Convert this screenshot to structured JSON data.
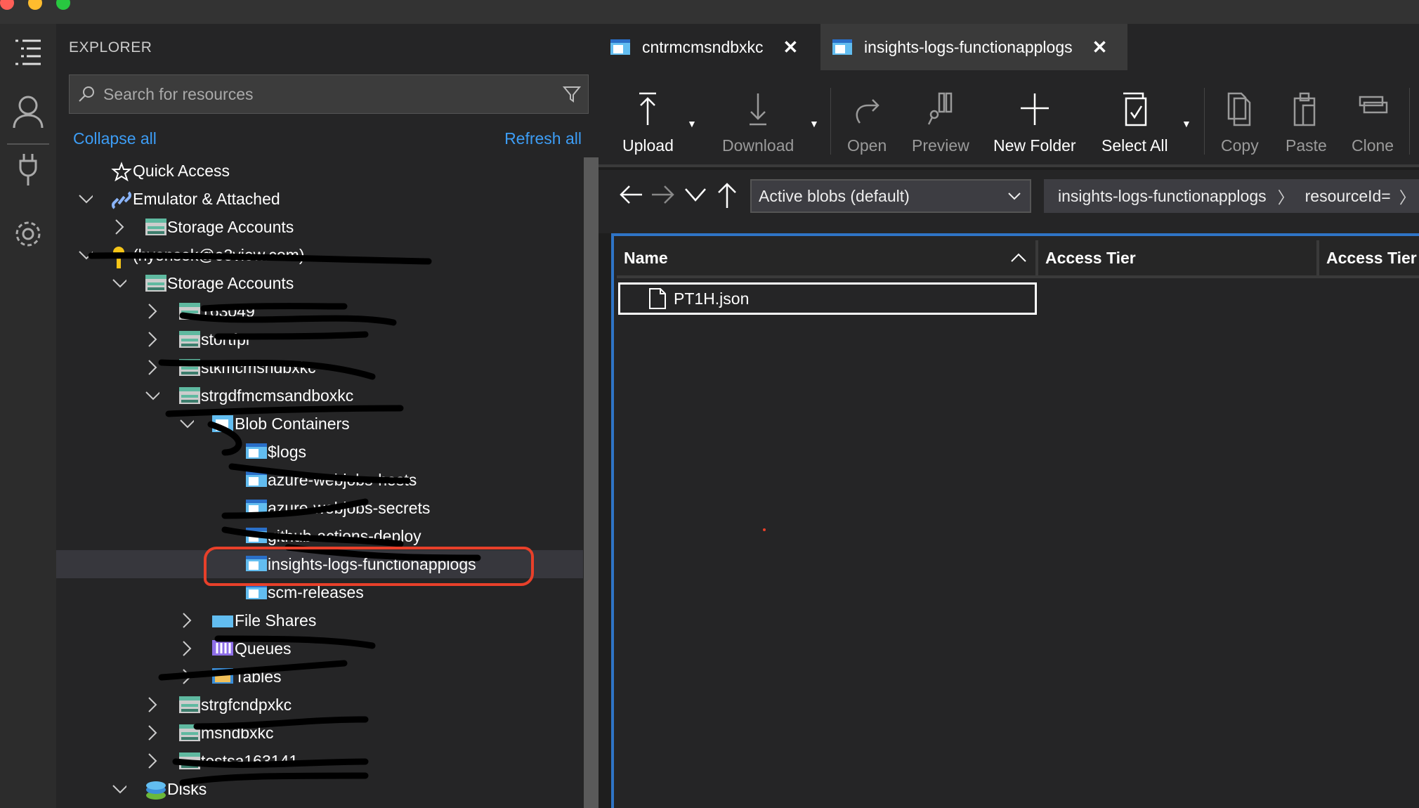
{
  "window": {
    "traffic_lights": [
      "#ff5f57",
      "#febc2e",
      "#28c840"
    ]
  },
  "activity_bar": [
    {
      "icon": "explorer-icon"
    },
    {
      "icon": "account-icon"
    },
    {
      "icon": "plug-icon"
    },
    {
      "icon": "gear-icon"
    }
  ],
  "sidebar": {
    "title": "EXPLORER",
    "search_placeholder": "Search for resources",
    "collapse_all": "Collapse all",
    "refresh_all": "Refresh all",
    "tree": [
      {
        "label": "Quick Access",
        "depth": 0,
        "state": "none",
        "icon": "quick-access"
      },
      {
        "label": "Emulator & Attached",
        "depth": 0,
        "state": "expanded",
        "icon": "link"
      },
      {
        "label": "Storage Accounts",
        "depth": 1,
        "state": "collapsed",
        "icon": "storage"
      },
      {
        "label": "(hyonsek@e3view.com)",
        "depth": 0,
        "state": "expanded",
        "icon": "key"
      },
      {
        "label": "Storage Accounts",
        "depth": 1,
        "state": "expanded",
        "icon": "storage"
      },
      {
        "label": "163049",
        "depth": 2,
        "state": "collapsed",
        "icon": "storage"
      },
      {
        "label": "stortfpr",
        "depth": 2,
        "state": "collapsed",
        "icon": "storage"
      },
      {
        "label": "stkmcmsndbxkc",
        "depth": 2,
        "state": "collapsed",
        "icon": "storage"
      },
      {
        "label": "strgdfmcmsandboxkc",
        "depth": 2,
        "state": "expanded",
        "icon": "storage"
      },
      {
        "label": "Blob Containers",
        "depth": 3,
        "state": "expanded",
        "icon": "blob"
      },
      {
        "label": "$logs",
        "depth": 4,
        "state": "none",
        "icon": "container"
      },
      {
        "label": "azure-webjobs-hosts",
        "depth": 4,
        "state": "none",
        "icon": "container"
      },
      {
        "label": "azure-webjobs-secrets",
        "depth": 4,
        "state": "none",
        "icon": "container"
      },
      {
        "label": "github-actions-deploy",
        "depth": 4,
        "state": "none",
        "icon": "container"
      },
      {
        "label": "insights-logs-functionapplogs",
        "depth": 4,
        "state": "none",
        "icon": "container",
        "selected": true
      },
      {
        "label": "scm-releases",
        "depth": 4,
        "state": "none",
        "icon": "container"
      },
      {
        "label": "File Shares",
        "depth": 3,
        "state": "collapsed",
        "icon": "fileshare"
      },
      {
        "label": "Queues",
        "depth": 3,
        "state": "collapsed",
        "icon": "queue"
      },
      {
        "label": "Tables",
        "depth": 3,
        "state": "collapsed",
        "icon": "table"
      },
      {
        "label": "strgfcndpxkc",
        "depth": 2,
        "state": "collapsed",
        "icon": "storage"
      },
      {
        "label": "msndbxkc",
        "depth": 2,
        "state": "collapsed",
        "icon": "storage"
      },
      {
        "label": "testsa163141",
        "depth": 2,
        "state": "collapsed",
        "icon": "storage"
      },
      {
        "label": "Disks",
        "depth": 1,
        "state": "expanded",
        "icon": "disk"
      }
    ]
  },
  "tabs": [
    {
      "label": "cntrmcmsndbxkc",
      "active": false
    },
    {
      "label": "insights-logs-functionapplogs",
      "active": true
    }
  ],
  "toolbar": {
    "upload": "Upload",
    "download": "Download",
    "open": "Open",
    "preview": "Preview",
    "new_folder": "New Folder",
    "select_all": "Select All",
    "copy": "Copy",
    "paste": "Paste",
    "clone": "Clone"
  },
  "nav": {
    "filter": "Active blobs (default)",
    "breadcrumb": [
      "insights-logs-functionapplogs",
      "resourceId="
    ]
  },
  "grid": {
    "columns": [
      "Name",
      "Access Tier",
      "Access Tier"
    ],
    "rows": [
      {
        "name": "PT1H.json"
      }
    ],
    "sort": "ascending"
  },
  "colors": {
    "accent": "#3d9df5",
    "selection_border": "#2f74c6",
    "annotation": "#e8402a"
  }
}
